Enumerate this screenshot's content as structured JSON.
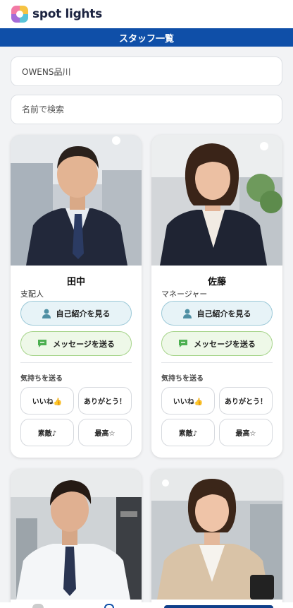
{
  "app": {
    "logo_text": "spot lights"
  },
  "header": {
    "title": "スタッフ一覧"
  },
  "filters": {
    "store_value": "OWENS品川",
    "search_placeholder": "名前で検索"
  },
  "staff": [
    {
      "name": "田中",
      "role": "支配人",
      "intro_label": "自己紹介を見る",
      "message_label": "メッセージを送る",
      "feelings_label": "気持ちを送る",
      "reactions": [
        "いいね👍",
        "ありがとう！",
        "素敵♪",
        "最高☆"
      ]
    },
    {
      "name": "佐藤",
      "role": "マネージャー",
      "intro_label": "自己紹介を見る",
      "message_label": "メッセージを送る",
      "feelings_label": "気持ちを送る",
      "reactions": [
        "いいね👍",
        "ありがとう！",
        "素敵♪",
        "最高☆"
      ]
    },
    {},
    {}
  ],
  "colors": {
    "brand_blue": "#0f4fa8",
    "intro_button_bg": "#e7f3f7",
    "message_button_bg": "#eef8e8",
    "message_icon": "#4caf50",
    "person_icon": "#4f8fa3"
  },
  "icons": {
    "intro": "person-icon",
    "message": "chat-bubble-icon"
  }
}
